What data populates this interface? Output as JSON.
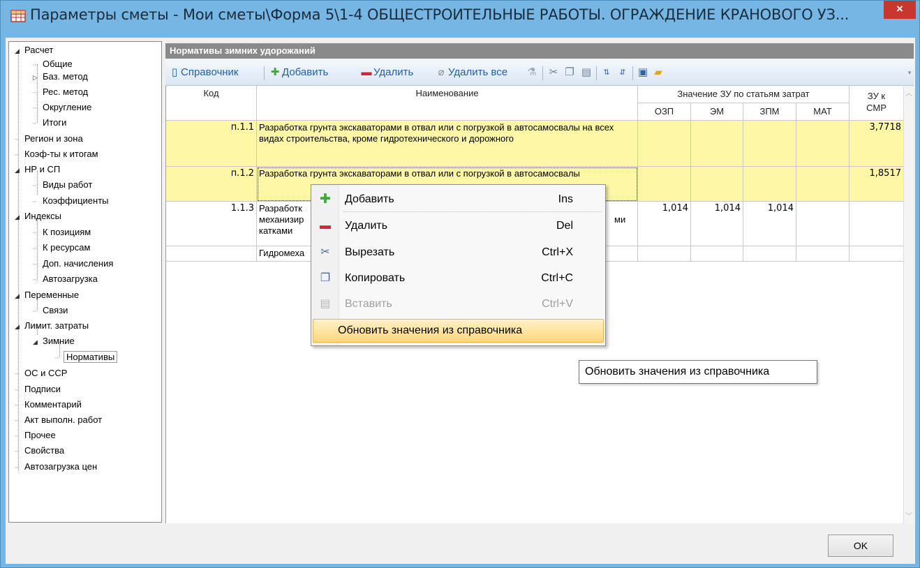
{
  "window": {
    "title": "Параметры сметы - Мои сметы\\Форма 5\\1-4 ОБЩЕСТРОИТЕЛЬНЫЕ РАБОТЫ. ОГРАЖДЕНИЕ КРАНОВОГО УЗ...",
    "close_glyph": "×",
    "app_icon": "table-icon"
  },
  "tree": {
    "items": [
      {
        "label": "Расчет",
        "expander": "◢"
      },
      {
        "label": "Общие"
      },
      {
        "label": "Баз. метод",
        "expander": "▷"
      },
      {
        "label": "Рес. метод"
      },
      {
        "label": "Округление"
      },
      {
        "label": "Итоги"
      },
      {
        "label": "Регион и зона"
      },
      {
        "label": "Коэф-ты к итогам"
      },
      {
        "label": "НР и СП",
        "expander": "◢"
      },
      {
        "label": "Виды работ"
      },
      {
        "label": "Коэффициенты"
      },
      {
        "label": "Индексы",
        "expander": "◢"
      },
      {
        "label": "К позициям"
      },
      {
        "label": "К ресурсам"
      },
      {
        "label": "Доп. начисления"
      },
      {
        "label": "Автозагрузка"
      },
      {
        "label": "Переменные",
        "expander": "◢"
      },
      {
        "label": "Связи"
      },
      {
        "label": "Лимит. затраты",
        "expander": "◢"
      },
      {
        "label": "Зимние",
        "expander": "◢"
      },
      {
        "label": "Нормативы"
      },
      {
        "label": "ОС и ССР"
      },
      {
        "label": "Подписи"
      },
      {
        "label": "Комментарий"
      },
      {
        "label": "Акт выполн. работ"
      },
      {
        "label": "Прочее"
      },
      {
        "label": "Свойства"
      },
      {
        "label": "Автозагрузка цен"
      }
    ]
  },
  "section": {
    "title": "Нормативы зимних удорожаний"
  },
  "toolbar": {
    "reference_label": "Справочник",
    "add_label": "Добавить",
    "delete_label": "Удалить",
    "delete_all_label": "Удалить все"
  },
  "grid": {
    "headers": {
      "code": "Код",
      "name": "Наименование",
      "group": "Значение ЗУ по статьям затрат",
      "ozp": "ОЗП",
      "em": "ЭМ",
      "zpm": "ЗПМ",
      "mat": "МАТ",
      "zu_line1": "ЗУ к",
      "zu_line2": "СМР"
    },
    "rows": [
      {
        "code": "п.1.1",
        "name": "Разработка грунта экскаваторами в отвал или с погрузкой в автосамосвалы на всех видах строительства, кроме гидротехнического и дорожного",
        "ozp": "",
        "em": "",
        "zpm": "",
        "mat": "",
        "zu": "3,7718"
      },
      {
        "code": "п.1.2",
        "name": "Разработка грунта экскаваторами в отвал или с погрузкой в автосамосвалы",
        "ozp": "",
        "em": "",
        "zpm": "",
        "mat": "",
        "zu": "1,8517"
      },
      {
        "code": "1.1.3",
        "name_line1": "Разработк",
        "name_line2": "механизир",
        "name_line2_end": "ми",
        "name_line3": "катками",
        "ozp": "1,014",
        "em": "1,014",
        "zpm": "1,014",
        "mat": "",
        "zu": ""
      },
      {
        "code": "",
        "name": "Гидромеха",
        "ozp": "",
        "em": "",
        "zpm": "",
        "mat": "",
        "zu": ""
      }
    ]
  },
  "context_menu": {
    "items": [
      {
        "label": "Добавить",
        "shortcut": "Ins",
        "icon": "plus-icon"
      },
      {
        "label": "Удалить",
        "shortcut": "Del",
        "icon": "minus-icon"
      },
      {
        "label": "Вырезать",
        "shortcut": "Ctrl+X",
        "icon": "scissors-icon"
      },
      {
        "label": "Копировать",
        "shortcut": "Ctrl+C",
        "icon": "copy-icon"
      },
      {
        "label": "Вставить",
        "shortcut": "Ctrl+V",
        "icon": "paste-icon",
        "disabled": true
      },
      {
        "label": "Обновить значения из справочника",
        "shortcut": "",
        "highlighted": true
      }
    ]
  },
  "tooltip": {
    "text": "Обновить значения из справочника"
  },
  "buttons": {
    "ok_label": "OK"
  },
  "colors": {
    "title_bar": "#76b6e4",
    "close_button": "#c7372f",
    "highlight_row": "#fdf7a6",
    "menu_highlight": "#fbd77c",
    "toolbar_text": "#1f5fa8"
  }
}
